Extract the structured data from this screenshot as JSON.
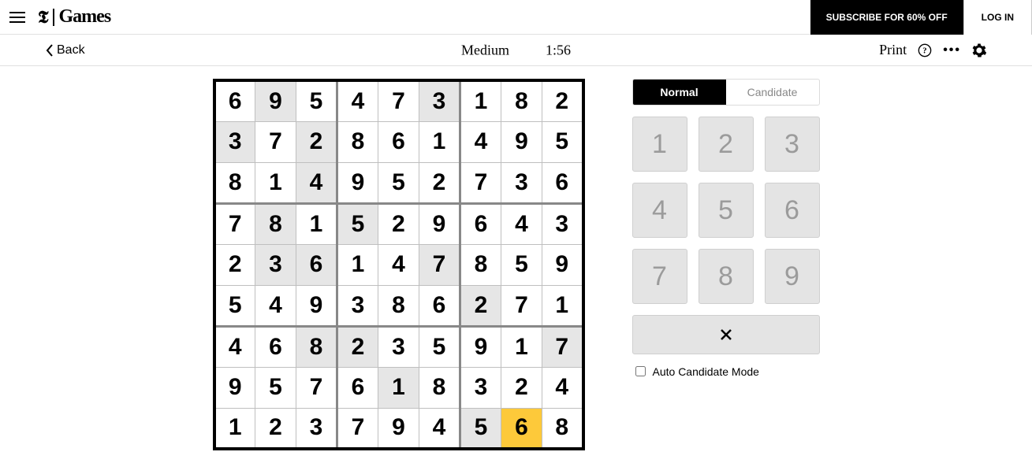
{
  "header": {
    "brand_letter": "𝕿",
    "brand_name": "Games",
    "subscribe_label": "SUBSCRIBE FOR 60% OFF",
    "login_label": "LOG IN"
  },
  "gamebar": {
    "back_label": "Back",
    "difficulty": "Medium",
    "timer": "1:56",
    "print_label": "Print"
  },
  "mode": {
    "normal_label": "Normal",
    "candidate_label": "Candidate"
  },
  "keypad": [
    "1",
    "2",
    "3",
    "4",
    "5",
    "6",
    "7",
    "8",
    "9"
  ],
  "auto_label": "Auto Candidate Mode",
  "selected": {
    "row": 8,
    "col": 7
  },
  "grid": [
    [
      {
        "v": "6",
        "given": false
      },
      {
        "v": "9",
        "given": true
      },
      {
        "v": "5",
        "given": false
      },
      {
        "v": "4",
        "given": false
      },
      {
        "v": "7",
        "given": false
      },
      {
        "v": "3",
        "given": true
      },
      {
        "v": "1",
        "given": false
      },
      {
        "v": "8",
        "given": false
      },
      {
        "v": "2",
        "given": false
      }
    ],
    [
      {
        "v": "3",
        "given": true
      },
      {
        "v": "7",
        "given": false
      },
      {
        "v": "2",
        "given": true
      },
      {
        "v": "8",
        "given": false
      },
      {
        "v": "6",
        "given": false
      },
      {
        "v": "1",
        "given": false
      },
      {
        "v": "4",
        "given": false
      },
      {
        "v": "9",
        "given": false
      },
      {
        "v": "5",
        "given": false
      }
    ],
    [
      {
        "v": "8",
        "given": false
      },
      {
        "v": "1",
        "given": false
      },
      {
        "v": "4",
        "given": true
      },
      {
        "v": "9",
        "given": false
      },
      {
        "v": "5",
        "given": false
      },
      {
        "v": "2",
        "given": false
      },
      {
        "v": "7",
        "given": false
      },
      {
        "v": "3",
        "given": false
      },
      {
        "v": "6",
        "given": false
      }
    ],
    [
      {
        "v": "7",
        "given": false
      },
      {
        "v": "8",
        "given": true
      },
      {
        "v": "1",
        "given": false
      },
      {
        "v": "5",
        "given": true
      },
      {
        "v": "2",
        "given": false
      },
      {
        "v": "9",
        "given": false
      },
      {
        "v": "6",
        "given": false
      },
      {
        "v": "4",
        "given": false
      },
      {
        "v": "3",
        "given": false
      }
    ],
    [
      {
        "v": "2",
        "given": false
      },
      {
        "v": "3",
        "given": true
      },
      {
        "v": "6",
        "given": true
      },
      {
        "v": "1",
        "given": false
      },
      {
        "v": "4",
        "given": false
      },
      {
        "v": "7",
        "given": true
      },
      {
        "v": "8",
        "given": false
      },
      {
        "v": "5",
        "given": false
      },
      {
        "v": "9",
        "given": false
      }
    ],
    [
      {
        "v": "5",
        "given": false
      },
      {
        "v": "4",
        "given": false
      },
      {
        "v": "9",
        "given": false
      },
      {
        "v": "3",
        "given": false
      },
      {
        "v": "8",
        "given": false
      },
      {
        "v": "6",
        "given": false
      },
      {
        "v": "2",
        "given": true
      },
      {
        "v": "7",
        "given": false
      },
      {
        "v": "1",
        "given": false
      }
    ],
    [
      {
        "v": "4",
        "given": false
      },
      {
        "v": "6",
        "given": false
      },
      {
        "v": "8",
        "given": true
      },
      {
        "v": "2",
        "given": true
      },
      {
        "v": "3",
        "given": false
      },
      {
        "v": "5",
        "given": false
      },
      {
        "v": "9",
        "given": false
      },
      {
        "v": "1",
        "given": false
      },
      {
        "v": "7",
        "given": true
      }
    ],
    [
      {
        "v": "9",
        "given": false
      },
      {
        "v": "5",
        "given": false
      },
      {
        "v": "7",
        "given": false
      },
      {
        "v": "6",
        "given": false
      },
      {
        "v": "1",
        "given": true
      },
      {
        "v": "8",
        "given": false
      },
      {
        "v": "3",
        "given": false
      },
      {
        "v": "2",
        "given": false
      },
      {
        "v": "4",
        "given": false
      }
    ],
    [
      {
        "v": "1",
        "given": false
      },
      {
        "v": "2",
        "given": false
      },
      {
        "v": "3",
        "given": false
      },
      {
        "v": "7",
        "given": false
      },
      {
        "v": "9",
        "given": false
      },
      {
        "v": "4",
        "given": false
      },
      {
        "v": "5",
        "given": true
      },
      {
        "v": "6",
        "given": false
      },
      {
        "v": "8",
        "given": false
      }
    ]
  ]
}
